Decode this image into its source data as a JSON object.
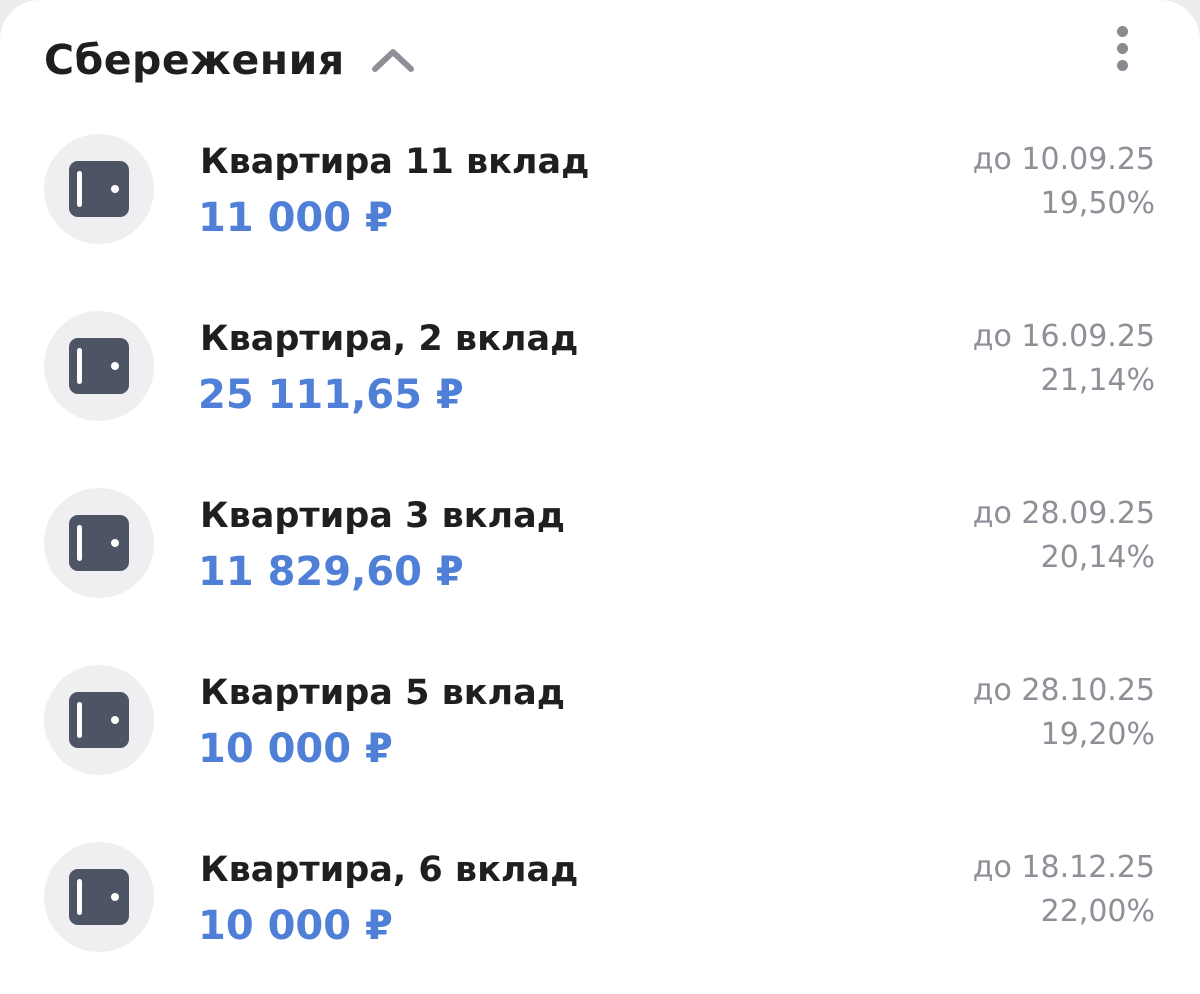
{
  "header": {
    "title": "Сбережения"
  },
  "accounts": [
    {
      "name": "Квартира 11 вклад",
      "amount": "11 000 ₽",
      "until": "до 10.09.25",
      "rate": "19,50%"
    },
    {
      "name": "Квартира, 2 вклад",
      "amount": "25 111,65 ₽",
      "until": "до 16.09.25",
      "rate": "21,14%"
    },
    {
      "name": "Квартира 3 вклад",
      "amount": "11 829,60 ₽",
      "until": "до 28.09.25",
      "rate": "20,14%"
    },
    {
      "name": "Квартира 5 вклад",
      "amount": "10 000 ₽",
      "until": "до 28.10.25",
      "rate": "19,20%"
    },
    {
      "name": "Квартира, 6 вклад",
      "amount": "10 000 ₽",
      "until": "до 18.12.25",
      "rate": "22,00%"
    }
  ],
  "icons": {
    "collapse": "chevron-up-icon",
    "menu": "more-vertical-icon",
    "account": "wallet-icon"
  },
  "colors": {
    "amount": "#4f7fd6",
    "icon": "#4d5464",
    "icon_bg": "#efeff2",
    "secondary_text": "#8e9097"
  }
}
